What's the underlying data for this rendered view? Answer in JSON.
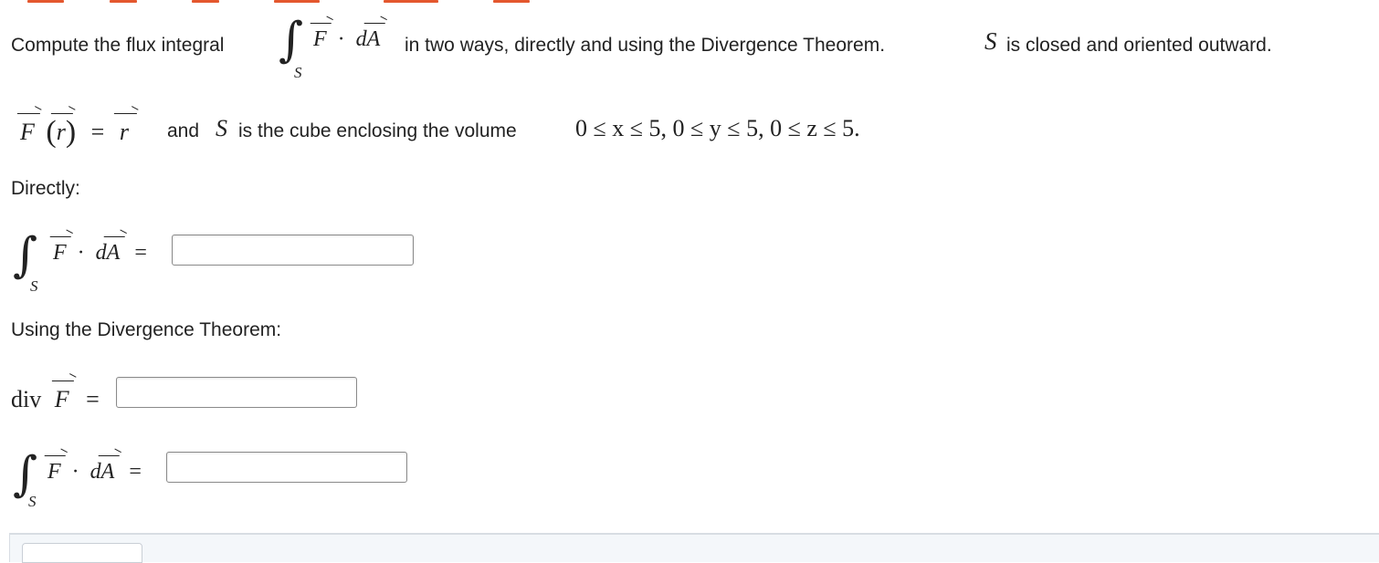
{
  "question": {
    "intro_text": "Compute the flux integral",
    "intro_after": "in two ways, directly and using the Divergence Theorem.",
    "closed_text": "is closed and oriented outward.",
    "surface_symbol": "S",
    "integral_sub": "S",
    "field_F": "F",
    "field_r": "r",
    "dot_dA_d": "d",
    "dA_A": "A",
    "equals": "=",
    "and_text": "and",
    "cube_text": "is the cube enclosing the volume",
    "volume_condition": "0 ≤ x ≤ 5,  0 ≤ y ≤ 5,  0 ≤ z ≤ 5."
  },
  "sections": {
    "directly_label": "Directly:",
    "divergence_label": "Using the Divergence Theorem:",
    "div_word": "div"
  },
  "answers": {
    "direct_value": "",
    "div_value": "",
    "div_theorem_value": ""
  },
  "colors": {
    "accent": "#e4572e",
    "text": "#222222",
    "input_border": "#8a8a8a",
    "panel_bg": "#f4f7fa"
  }
}
